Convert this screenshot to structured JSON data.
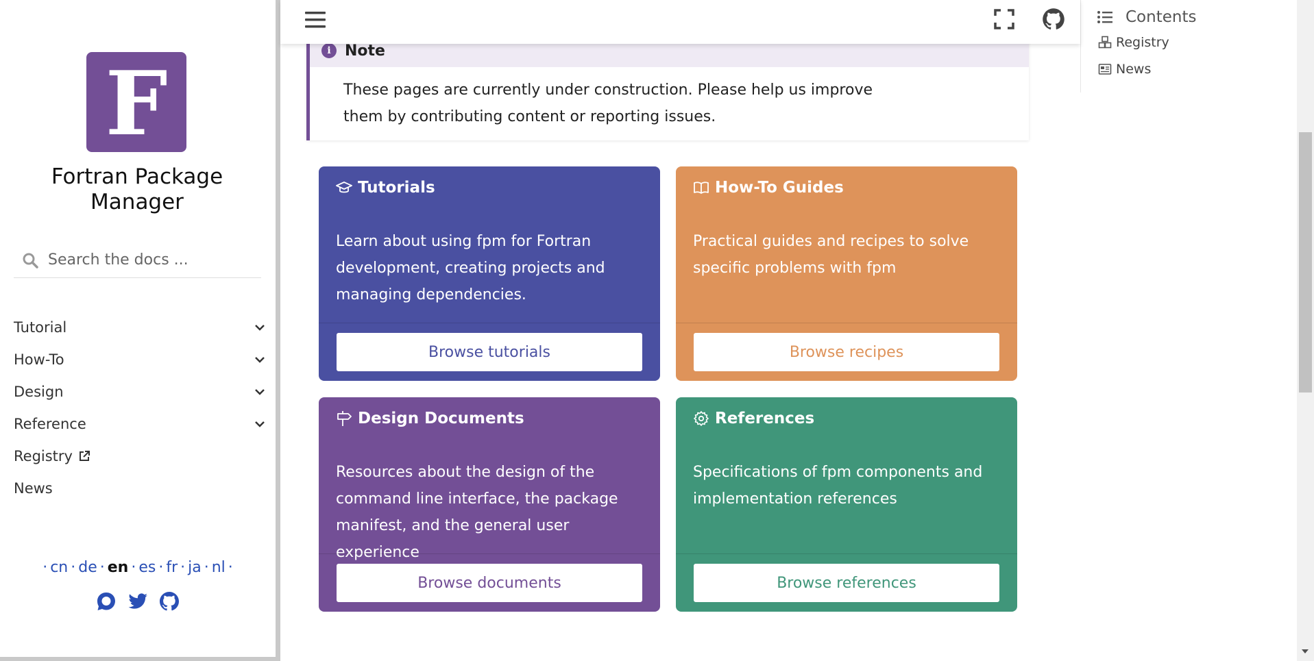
{
  "sidebar": {
    "logo_letter": "F",
    "site_title": "Fortran Package Manager",
    "search_placeholder": "Search the docs ...",
    "nav": [
      {
        "label": "Tutorial",
        "expandable": true
      },
      {
        "label": "How-To",
        "expandable": true
      },
      {
        "label": "Design",
        "expandable": true
      },
      {
        "label": "Reference",
        "expandable": true
      },
      {
        "label": "Registry",
        "external": true
      },
      {
        "label": "News"
      }
    ],
    "languages": [
      "cn",
      "de",
      "en",
      "es",
      "fr",
      "ja",
      "nl"
    ],
    "current_language": "en",
    "socials": [
      "discourse-icon",
      "twitter-icon",
      "github-icon"
    ]
  },
  "header": {
    "icons": [
      "menu-icon",
      "fullscreen-icon",
      "github-icon"
    ]
  },
  "note": {
    "title": "Note",
    "text": "These pages are currently under construction. Please help us improve them by contributing content or reporting issues."
  },
  "cards": {
    "tutorials": {
      "title": "Tutorials",
      "icon": "graduation-cap-icon",
      "text": "Learn about using fpm for Fortran development, creating projects and managing dependencies.",
      "button": "Browse tutorials",
      "color": "#4a50a1"
    },
    "howto": {
      "title": "How-To Guides",
      "icon": "book-open-icon",
      "text": "Practical guides and recipes to solve specific problems with fpm",
      "button": "Browse recipes",
      "color": "#de935a"
    },
    "design": {
      "title": "Design Documents",
      "icon": "signpost-icon",
      "text": "Resources about the design of the command line interface, the package manifest, and the general user experience",
      "button": "Browse documents",
      "color": "#734f96"
    },
    "references": {
      "title": "References",
      "icon": "gear-icon",
      "text": "Specifications of fpm components and implementation references",
      "button": "Browse references",
      "color": "#40967a"
    }
  },
  "toc": {
    "title": "Contents",
    "items": [
      {
        "label": "Registry",
        "icon": "cubes-icon"
      },
      {
        "label": "News",
        "icon": "newspaper-icon"
      }
    ]
  }
}
